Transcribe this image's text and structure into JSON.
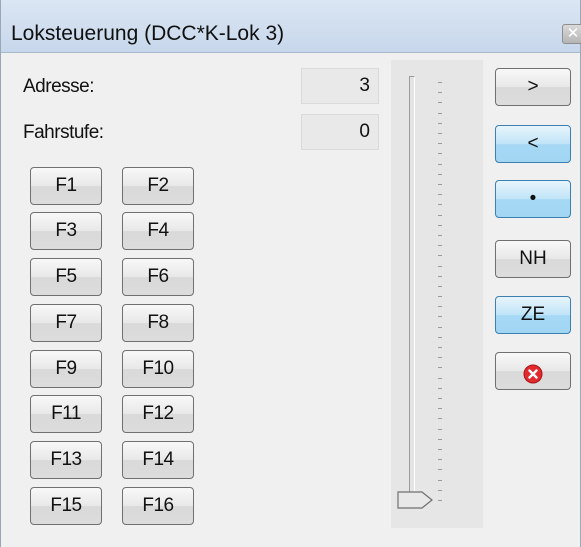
{
  "window": {
    "title": "Loksteuerung (DCC*K-Lok 3)",
    "close_icon": "close-icon"
  },
  "fields": {
    "adresse_label": "Adresse:",
    "adresse_value": "3",
    "fahrstufe_label": "Fahrstufe:",
    "fahrstufe_value": "0"
  },
  "function_buttons": [
    "F1",
    "F2",
    "F3",
    "F4",
    "F5",
    "F6",
    "F7",
    "F8",
    "F9",
    "F10",
    "F11",
    "F12",
    "F13",
    "F14",
    "F15",
    "F16"
  ],
  "speed_slider": {
    "value": 0
  },
  "control_buttons": {
    "forward": ">",
    "backward": "<",
    "stop": "•",
    "nh": "NH",
    "ze": "ZE",
    "emergency_icon": "error-icon"
  },
  "colors": {
    "active_button": "#a6d8f4",
    "emergency": "#e1292e"
  }
}
